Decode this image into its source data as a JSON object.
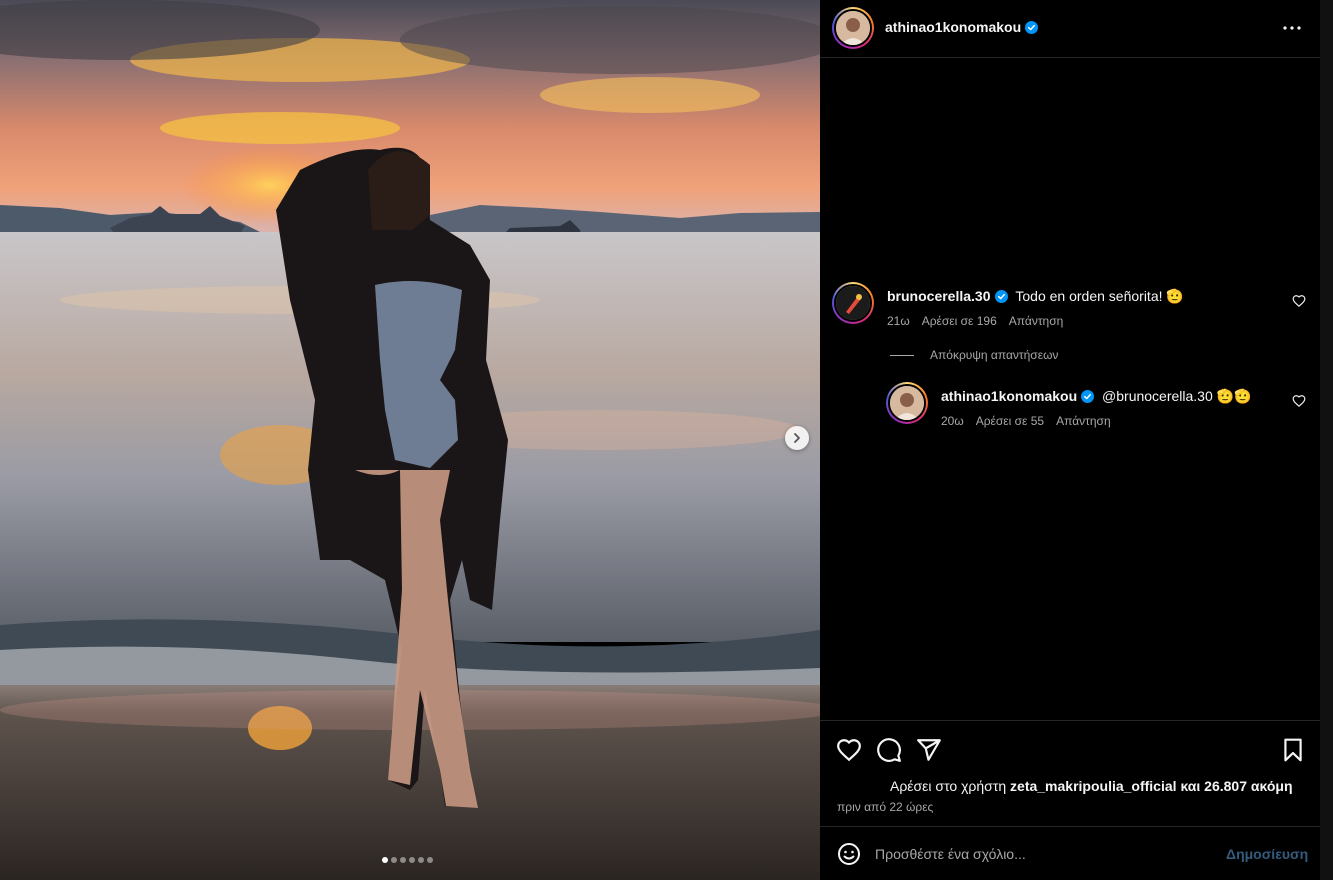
{
  "post": {
    "author": "athinao1konomakou",
    "carousel": {
      "slide_count": 6,
      "active_index": 0
    }
  },
  "icons": {
    "verified": "verified-badge-icon",
    "more": "more-options-icon",
    "like": "heart-icon",
    "comment": "comment-bubble-icon",
    "share": "paper-plane-icon",
    "save": "bookmark-icon",
    "emoji": "emoji-face-icon",
    "next": "chevron-right-icon"
  },
  "comments": [
    {
      "username": "brunocerella.30",
      "text": "Todo en orden señorita! 🫡",
      "time": "21ω",
      "likes": "Αρέσει σε 196",
      "reply": "Απάντηση"
    }
  ],
  "hide_replies": "Απόκρυψη απαντήσεων",
  "replies": [
    {
      "username": "athinao1konomakou",
      "text": "@brunocerella.30 🫡🫡",
      "time": "20ω",
      "likes": "Αρέσει σε 55",
      "reply": "Απάντηση"
    }
  ],
  "likes_summary": {
    "prefix": "Αρέσει στο χρήστη",
    "user": "zeta_makripoulia_official",
    "suffix": "και 26.807 ακόμη"
  },
  "time_ago": "πριν από 22 ώρες",
  "comment_box": {
    "placeholder": "Προσθέστε ένα σχόλιο...",
    "post_label": "Δημοσίευση"
  },
  "colors": {
    "background": "#000000",
    "divider": "#262626",
    "secondary_text": "#a8a8a8",
    "verified": "#0095f6",
    "post_button_disabled": "#355b7e"
  }
}
